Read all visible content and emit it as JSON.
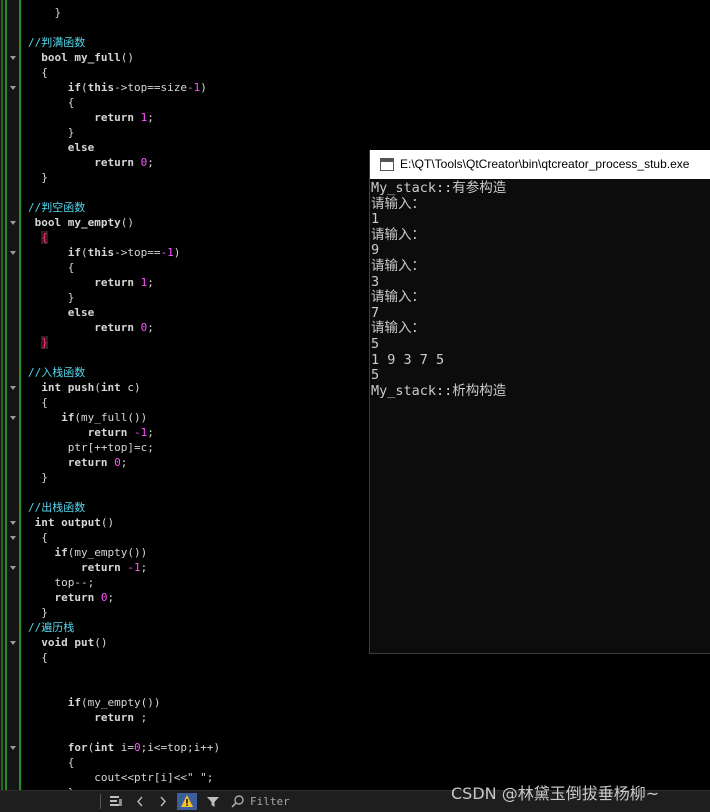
{
  "editor": {
    "lines": [
      "    }",
      "",
      "//判满函数",
      "  bool my_full()",
      "  {",
      "      if(this->top==size-1)",
      "      {",
      "          return 1;",
      "      }",
      "      else",
      "          return 0;",
      "  }",
      "",
      "//判空函数",
      " bool my_empty()",
      "  {",
      "      if(this->top==-1)",
      "      {",
      "          return 1;",
      "      }",
      "      else",
      "          return 0;",
      "  }",
      "",
      "//入栈函数",
      "  int push(int c)",
      "  {",
      "     if(my_full())",
      "         return -1;",
      "      ptr[++top]=c;",
      "      return 0;",
      "  }",
      "",
      "//出栈函数",
      " int output()",
      "  {",
      "    if(my_empty())",
      "        return -1;",
      "    top--;",
      "    return 0;",
      "  }",
      "//遍历栈",
      "  void put()",
      "  {",
      "",
      "",
      "      if(my_empty())",
      "          return ;",
      "",
      "      for(int i=0;i<=top;i++)",
      "      {",
      "          cout<<ptr[i]<<\" \";",
      "      }"
    ]
  },
  "console": {
    "title": "E:\\QT\\Tools\\QtCreator\\bin\\qtcreator_process_stub.exe",
    "lines": [
      "My_stack::有参构造",
      "请输入：",
      "1",
      "请输入：",
      "9",
      "请输入：",
      "3",
      "请输入：",
      "7",
      "请输入：",
      "5",
      "1 9 3 7 5",
      "5",
      "My_stack::析构构造"
    ]
  },
  "statusbar": {
    "filter_placeholder": "Filter"
  },
  "watermark": "CSDN @林黛玉倒拔垂杨柳~",
  "colors": {
    "background": "#000000",
    "comment": "#55d7ee",
    "number": "#ff55ff",
    "brace_highlight": "#ff3a5e",
    "console_text": "#cccccc",
    "gutter_green": "#2a8a2a",
    "warning_button": "#3a5f9a"
  },
  "icons": [
    "fold-arrow-icon",
    "console-window-icon",
    "build-icon",
    "chevron-left-icon",
    "chevron-right-icon",
    "warning-icon",
    "filter-icon",
    "search-icon"
  ]
}
